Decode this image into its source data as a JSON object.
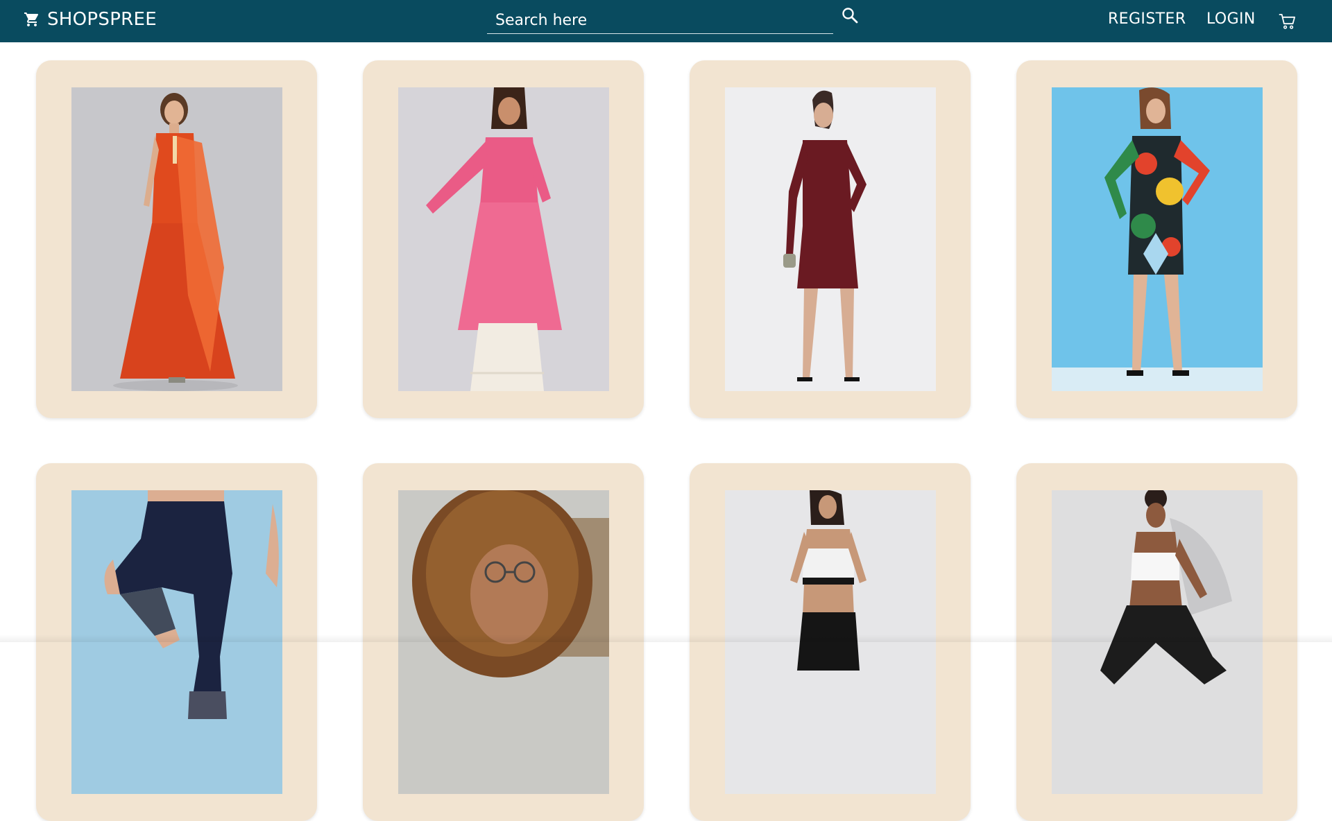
{
  "header": {
    "brand_icon": "cart-solid-icon",
    "brand": "SHOPSPREE",
    "search": {
      "placeholder": "Search here",
      "value": "",
      "icon": "search-icon"
    },
    "links": {
      "register": "REGISTER",
      "login": "LOGIN"
    },
    "cart_icon": "cart-outline-icon",
    "colors": {
      "bar": "#094b5f",
      "text": "#ffffff"
    }
  },
  "products": [
    {
      "image": "woman-in-orange-anarkali-with-dupatta",
      "image_bg": "#c7c7cb"
    },
    {
      "image": "woman-in-pink-printed-kurta-with-white-palazzo",
      "image_bg": "#d6d4d9"
    },
    {
      "image": "woman-in-maroon-shimmer-bodycon-dress",
      "image_bg": "#eeeef0"
    },
    {
      "image": "woman-in-tropical-print-long-sleeve-dress",
      "image_bg": "#6fc3ea"
    },
    {
      "image": "legs-in-navy-mesh-leggings",
      "image_bg": "#9fcbe2"
    },
    {
      "image": "woman-with-curly-hair-and-glasses",
      "image_bg": "#c9c9c5"
    },
    {
      "image": "woman-in-black-white-sports-bra-and-leggings",
      "image_bg": "#e6e6e8"
    },
    {
      "image": "woman-in-white-sports-bra-and-black-leggings",
      "image_bg": "#dededf"
    }
  ],
  "card_color": "#f2e4d1"
}
